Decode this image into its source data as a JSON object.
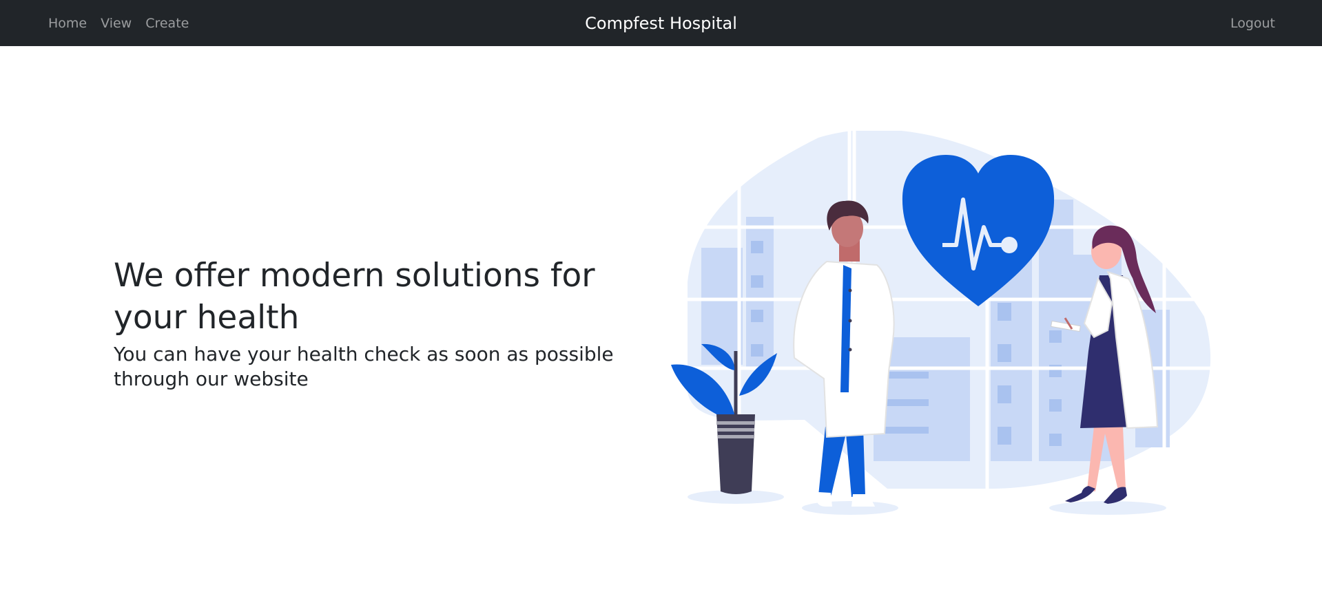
{
  "navbar": {
    "links": [
      {
        "label": "Home"
      },
      {
        "label": "View"
      },
      {
        "label": "Create"
      }
    ],
    "brand": "Compfest Hospital",
    "logout": "Logout"
  },
  "hero": {
    "title": "We offer modern solutions for your health",
    "subtitle": "You can have your health check as soon as possible through our website"
  },
  "colors": {
    "navbar_bg": "#212529",
    "accent_blue": "#0d5fd9",
    "light_blue": "#e6eefb"
  },
  "illustration": {
    "icons": [
      "heart-pulse-icon",
      "doctor-male",
      "doctor-female",
      "potted-plant"
    ]
  }
}
